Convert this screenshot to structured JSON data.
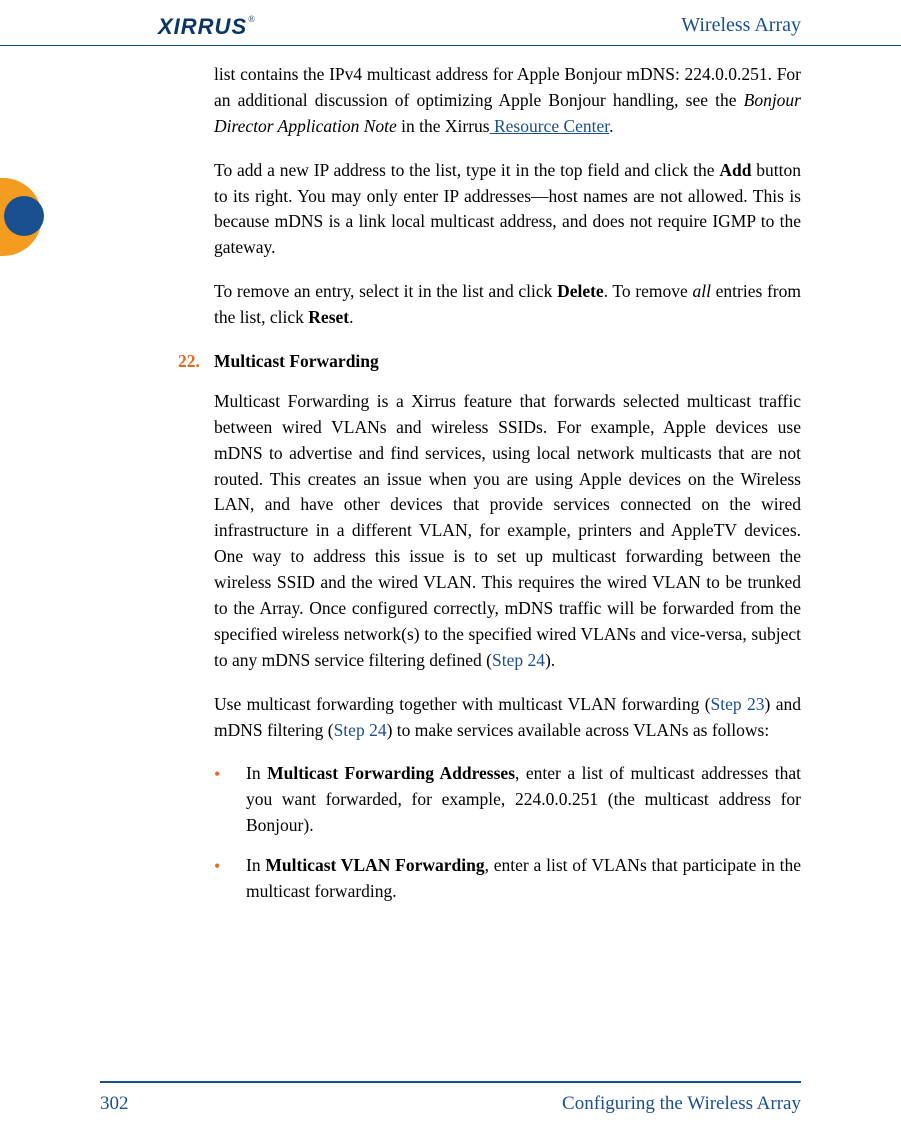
{
  "header": {
    "logo_text": "XIRRUS",
    "logo_r": "®",
    "title": "Wireless Array"
  },
  "content": {
    "p1_a": "list contains the IPv4 multicast address for Apple Bonjour mDNS: 224.0.0.251. For an additional discussion of optimizing Apple Bonjour handling, see the ",
    "p1_italic": "Bonjour Director Application Note",
    "p1_b": " in the Xirrus",
    "p1_link": " Resource Center",
    "p1_c": ".",
    "p2_a": "To add a new IP address to the list, type it in the top field and click the ",
    "p2_bold": "Add",
    "p2_b": " button to its right. You may only enter IP addresses—host names are not allowed. This is because mDNS is a link local multicast address, and does not require IGMP to the gateway.",
    "p3_a": "To remove an entry, select it in the list and click ",
    "p3_bold1": "Delete",
    "p3_b": ". To remove ",
    "p3_italic": "all",
    "p3_c": " entries from the list, click ",
    "p3_bold2": "Reset",
    "p3_d": ".",
    "section_num": "22.",
    "section_title": "Multicast Forwarding",
    "p4_a": "Multicast Forwarding is a Xirrus feature that forwards selected multicast traffic between wired VLANs and wireless SSIDs. For example, Apple devices use mDNS to advertise and find services, using local network multicasts that are not routed. This creates an issue when you are using Apple devices on the Wireless LAN, and have other devices that provide services connected on the wired infrastructure in a different VLAN, for example, printers and AppleTV devices. One way to address this issue is to set up multicast forwarding between the wireless SSID and the wired VLAN. This requires the wired VLAN to be trunked to the Array. Once configured correctly, mDNS traffic will be forwarded from the specified wireless network(s) to the specified wired VLANs and vice-versa, subject to any mDNS service filtering defined (",
    "p4_step24": "Step 24",
    "p4_b": ").",
    "p5_a": "Use multicast forwarding together with multicast VLAN forwarding (",
    "p5_step23": "Step 23",
    "p5_b": ") and mDNS filtering (",
    "p5_step24": "Step 24",
    "p5_c": ") to make services available across VLANs as follows:",
    "bullets": [
      {
        "a": "In ",
        "bold": "Multicast Forwarding Addresses",
        "b": ", enter a list of multicast addresses that you want forwarded, for example, 224.0.0.251 (the multicast address for Bonjour)."
      },
      {
        "a": "In ",
        "bold": "Multicast VLAN Forwarding",
        "b": ", enter a list of VLANs that participate in the multicast forwarding."
      }
    ]
  },
  "footer": {
    "page": "302",
    "section": "Configuring the Wireless Array"
  }
}
